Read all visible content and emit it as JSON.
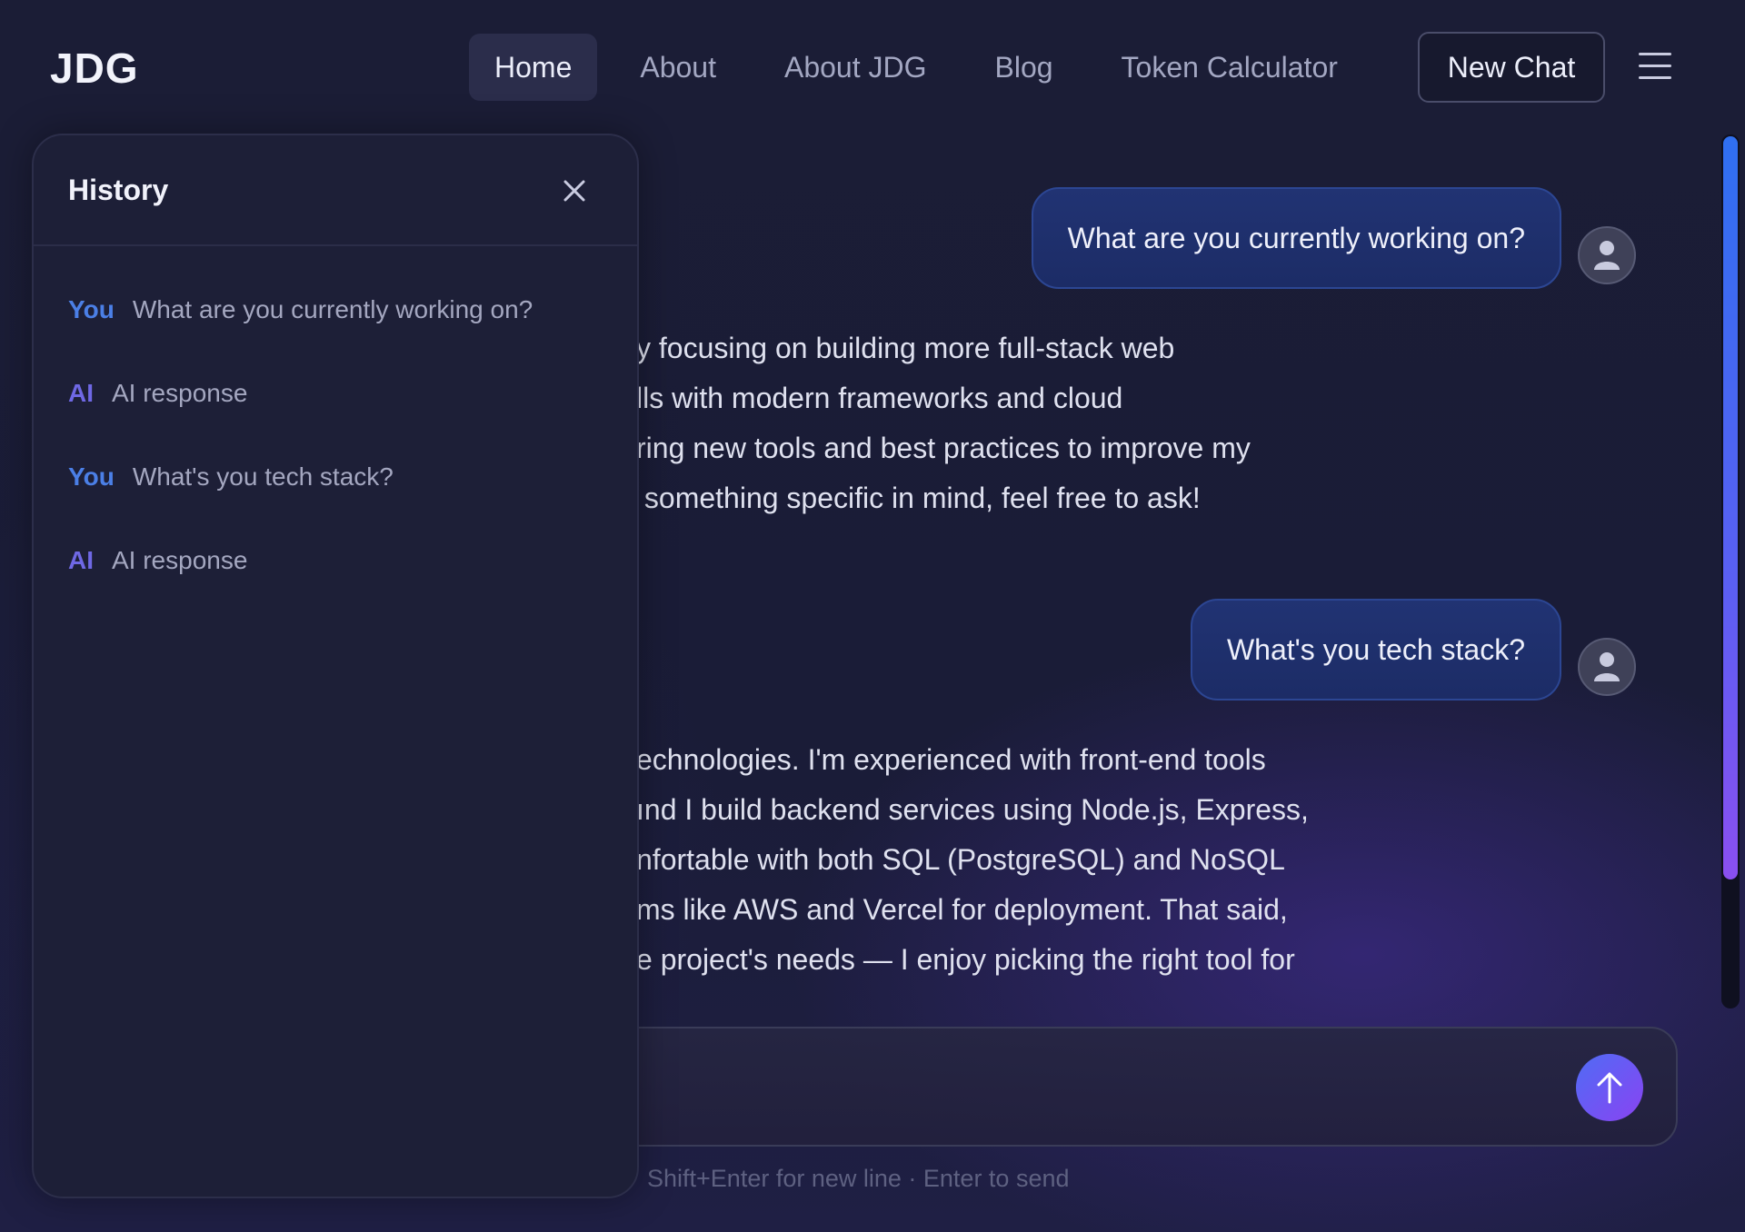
{
  "header": {
    "logo": "JDG",
    "nav": [
      {
        "label": "Home",
        "active": true
      },
      {
        "label": "About",
        "active": false
      },
      {
        "label": "About JDG",
        "active": false
      },
      {
        "label": "Blog",
        "active": false
      },
      {
        "label": "Token Calculator",
        "active": false
      }
    ],
    "new_chat_label": "New Chat",
    "menu_icon": "hamburger-menu-icon"
  },
  "history": {
    "title": "History",
    "close_icon": "close-icon",
    "items": [
      {
        "role": "You",
        "text": "What are you currently working on?"
      },
      {
        "role": "AI",
        "text": "AI response"
      },
      {
        "role": "You",
        "text": "What's you tech stack?"
      },
      {
        "role": "AI",
        "text": "AI response"
      }
    ]
  },
  "chat": {
    "messages": [
      {
        "sender": "user",
        "text": "What are you currently working on?"
      },
      {
        "sender": "ai",
        "lines": [
          "y focusing on building more full-stack web",
          "lls with modern frameworks and cloud",
          "ring new tools and best practices to improve my",
          " something specific in mind, feel free to ask!"
        ]
      },
      {
        "sender": "user",
        "text": "What's you tech stack?"
      },
      {
        "sender": "ai",
        "lines": [
          "echnologies. I'm experienced with front-end tools",
          "ınd I build backend services using Node.js, Express,",
          "nfortable with both SQL (PostgreSQL) and NoSQL",
          "ms like AWS and Vercel for deployment. That said,",
          "e project's needs — I enjoy picking the right tool for"
        ]
      }
    ]
  },
  "composer": {
    "placeholder": "",
    "send_icon": "arrow-up-icon",
    "hint": "Shift+Enter for new line · Enter to send"
  },
  "colors": {
    "background": "#1a1c37",
    "user_bubble": "#1e2f6b",
    "you_label": "#4b7fe6",
    "ai_label": "#6f68e4",
    "send_gradient_start": "#4f6cf5",
    "send_gradient_end": "#8a43f2"
  }
}
